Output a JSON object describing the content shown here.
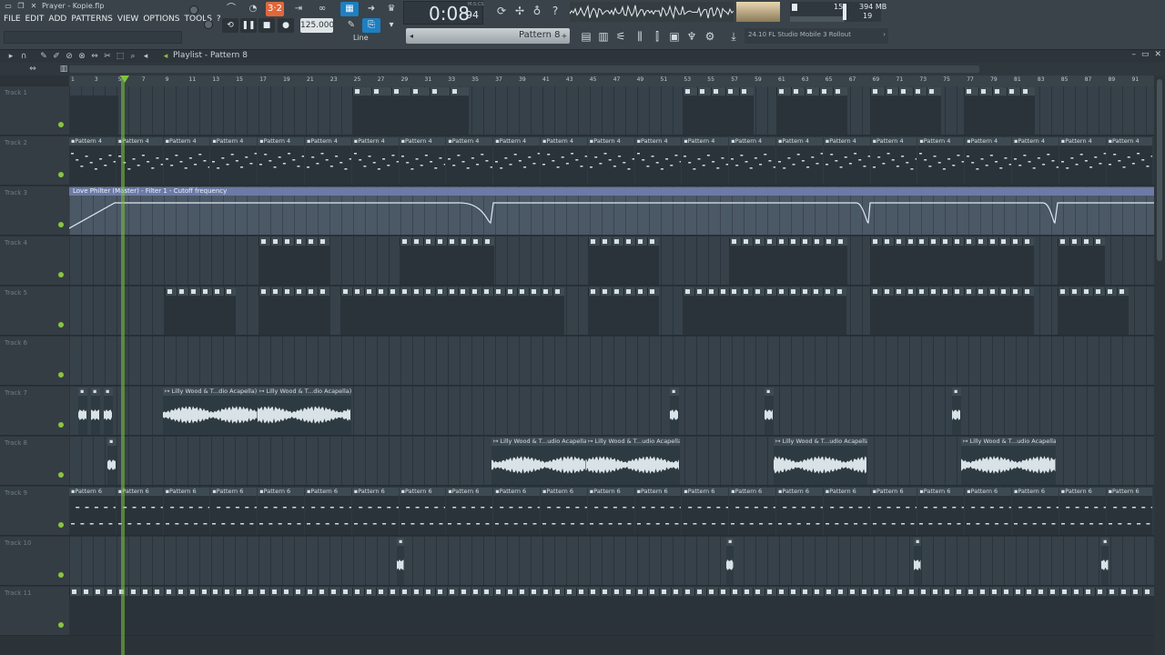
{
  "window": {
    "title": "Prayer - Kopie.flp"
  },
  "menu": [
    "FILE",
    "EDIT",
    "ADD",
    "PATTERNS",
    "VIEW",
    "OPTIONS",
    "TOOLS",
    "?"
  ],
  "transport": {
    "tempo": "125.000",
    "time_main": "0:08",
    "time_sub": "94",
    "time_label": "M:S:CS"
  },
  "monitor": {
    "cpu": "15",
    "memory": "394 MB",
    "polyphony": "19"
  },
  "pattern_selector": {
    "label": "Pattern 8"
  },
  "snap_mode": "Line",
  "news": {
    "text": "24.10  FL Studio Mobile 3 Rollout"
  },
  "playlist": {
    "title": "Playlist - Pattern 8"
  },
  "ruler": {
    "bars": [
      "1",
      "3",
      "5",
      "7",
      "9",
      "11",
      "13",
      "15",
      "17",
      "19",
      "21",
      "23",
      "25",
      "27",
      "29",
      "31",
      "33",
      "35",
      "37",
      "39",
      "41",
      "43",
      "45",
      "47",
      "49",
      "51",
      "53",
      "55",
      "57",
      "59",
      "61",
      "63",
      "65",
      "67",
      "69",
      "71",
      "73",
      "75",
      "77",
      "79",
      "81",
      "83",
      "85",
      "87",
      "89",
      "91"
    ]
  },
  "tracks": [
    "Track 1",
    "Track 2",
    "Track 3",
    "Track 4",
    "Track 5",
    "Track 6",
    "Track 7",
    "Track 8",
    "Track 9",
    "Track 10",
    "Track 11"
  ],
  "clip_names": {
    "pattern4": "Pattern 4",
    "pattern6": "Pattern 6",
    "automation": "Love Philter (Master) - Filter 1 - Cutoff frequency",
    "audio_a": "Lilly Wood & T...dio Acapella)",
    "audio_b": "Lilly Wood & T...udio Acapella)"
  },
  "colors": {
    "accent": "#7fc43c",
    "automation": "#6c7aa5",
    "record": "#e0673a",
    "active": "#1e7fc1"
  }
}
